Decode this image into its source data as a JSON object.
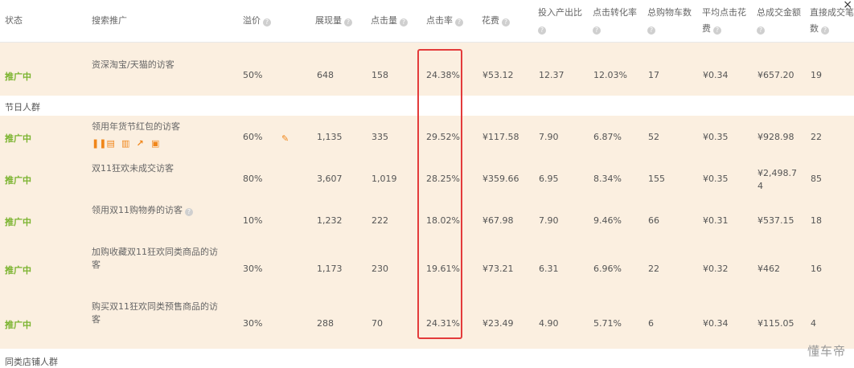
{
  "header": {
    "status": "状态",
    "search": "搜索推广",
    "premium": "溢价",
    "impressions": "展现量",
    "clicks": "点击量",
    "ctr": "点击率",
    "cost": "花费",
    "roi_line1": "投入产出比",
    "cvr": "点击转化率",
    "carts": "总购物车数",
    "cpc_line1": "平均点击花",
    "cpc_line2": "费",
    "gmv": "总成交金额",
    "direct_line1": "直接成交笔",
    "direct_line2": "数"
  },
  "help_icon": "?",
  "close_icon": "×",
  "group1_label": "节日人群",
  "group2_label": "同类店铺人群",
  "rows": [
    {
      "status": "推广中",
      "name": "资深淘宝/天猫的访客",
      "premium": "50%",
      "impressions": "648",
      "clicks": "158",
      "ctr": "24.38%",
      "cost": "¥53.12",
      "roi": "12.37",
      "cvr": "12.03%",
      "carts": "17",
      "cpc": "¥0.34",
      "gmv": "¥657.20",
      "direct": "19"
    },
    {
      "status": "推广中",
      "name": "领用年货节红包的访客",
      "premium": "60%",
      "impressions": "1,135",
      "clicks": "335",
      "ctr": "29.52%",
      "cost": "¥117.58",
      "roi": "7.90",
      "cvr": "6.87%",
      "carts": "52",
      "cpc": "¥0.35",
      "gmv": "¥928.98",
      "direct": "22"
    },
    {
      "status": "推广中",
      "name": "双11狂欢未成交访客",
      "premium": "80%",
      "impressions": "3,607",
      "clicks": "1,019",
      "ctr": "28.25%",
      "cost": "¥359.66",
      "roi": "6.95",
      "cvr": "8.34%",
      "carts": "155",
      "cpc": "¥0.35",
      "gmv_line1": "¥2,498.7",
      "gmv_line2": "4",
      "direct": "85"
    },
    {
      "status": "推广中",
      "name": "领用双11购物券的访客",
      "premium": "10%",
      "impressions": "1,232",
      "clicks": "222",
      "ctr": "18.02%",
      "cost": "¥67.98",
      "roi": "7.90",
      "cvr": "9.46%",
      "carts": "66",
      "cpc": "¥0.31",
      "gmv": "¥537.15",
      "direct": "18"
    },
    {
      "status": "推广中",
      "name_line1": "加购收藏双11狂欢同类商品的访",
      "name_line2": "客",
      "premium": "30%",
      "impressions": "1,173",
      "clicks": "230",
      "ctr": "19.61%",
      "cost": "¥73.21",
      "roi": "6.31",
      "cvr": "6.96%",
      "carts": "22",
      "cpc": "¥0.32",
      "gmv": "¥462",
      "direct": "16"
    },
    {
      "status": "推广中",
      "name_line1": "购买双11狂欢同类预售商品的访",
      "name_line2": "客",
      "premium": "30%",
      "impressions": "288",
      "clicks": "70",
      "ctr": "24.31%",
      "cost": "¥23.49",
      "roi": "4.90",
      "cvr": "5.71%",
      "carts": "6",
      "cpc": "¥0.34",
      "gmv": "¥115.05",
      "direct": "4"
    }
  ],
  "row_ops": [
    "pause-icon",
    "document-icon",
    "trash-icon",
    "chart-icon",
    "report-icon"
  ],
  "watermark": "懂车帝",
  "colors": {
    "row_bg": "#fbefe0",
    "status_green": "#7ab32e",
    "highlight_red": "#e33b3b",
    "op_orange": "#f0861a"
  }
}
